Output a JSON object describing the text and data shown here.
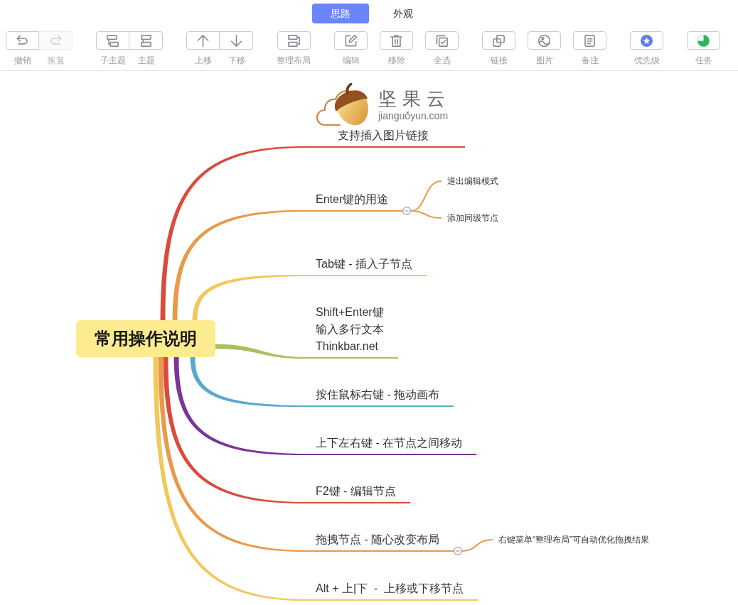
{
  "tabs": [
    {
      "label": "思路",
      "selected": true
    },
    {
      "label": "外观",
      "selected": false
    }
  ],
  "toolbar": [
    {
      "label": "撤销",
      "disabled": false
    },
    {
      "label": "恢复",
      "disabled": true
    },
    {
      "label": "子主题",
      "disabled": false
    },
    {
      "label": "主题",
      "disabled": false
    },
    {
      "label": "上移",
      "disabled": false
    },
    {
      "label": "下移",
      "disabled": false
    },
    {
      "label": "整理布局",
      "disabled": false
    },
    {
      "label": "编辑",
      "disabled": false
    },
    {
      "label": "移除",
      "disabled": false
    },
    {
      "label": "全选",
      "disabled": false
    },
    {
      "label": "链接",
      "disabled": false
    },
    {
      "label": "图片",
      "disabled": false
    },
    {
      "label": "备注",
      "disabled": false
    },
    {
      "label": "优先级",
      "disabled": false
    },
    {
      "label": "任务",
      "disabled": false
    }
  ],
  "mind_map": {
    "root": "常用操作说明",
    "branches": [
      {
        "lines": [
          "支持插入图片链接"
        ],
        "color": "#d94c3d",
        "image": {
          "title": "坚果云",
          "caption": "jianguǒyun.com"
        }
      },
      {
        "lines": [
          "Enter键的用途"
        ],
        "color": "#e8994a",
        "expanded": true,
        "children": [
          "退出编辑模式",
          "添加同级节点"
        ]
      },
      {
        "lines": [
          "Tab键 - 插入子节点"
        ],
        "color": "#f2c75c"
      },
      {
        "lines": [
          "Shift+Enter键",
          "输入多行文本",
          "Thinkbar.net"
        ],
        "color": "#a9c25d"
      },
      {
        "lines": [
          "按住鼠标右键 - 拖动画布"
        ],
        "color": "#5aa8d0"
      },
      {
        "lines": [
          "上下左右键 - 在节点之间移动"
        ],
        "color": "#7b3596"
      },
      {
        "lines": [
          "F2键 - 编辑节点"
        ],
        "color": "#d94c3d"
      },
      {
        "lines": [
          "拖拽节点 - 随心改变布局"
        ],
        "color": "#e8994a",
        "expanded": true,
        "children": [
          "右键菜单“整理布局”可自动优化拖拽结果"
        ]
      },
      {
        "lines": [
          "Alt + 上|下  -  上移或下移节点"
        ],
        "color": "#f2c75c"
      }
    ]
  }
}
